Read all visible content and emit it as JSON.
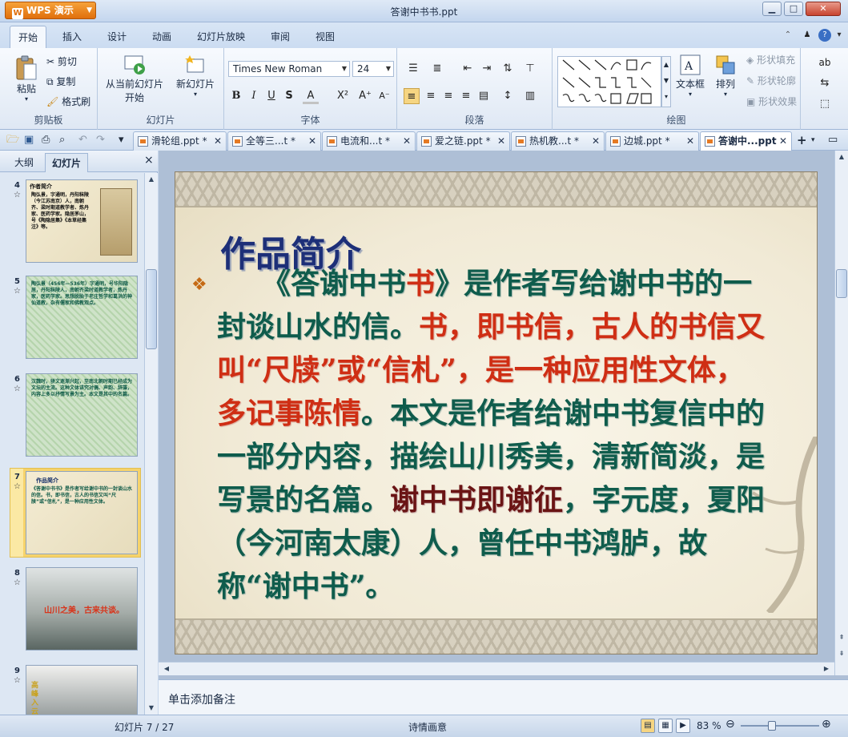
{
  "app": {
    "brand": "WPS 演示",
    "window_title": "答谢中书书.ppt"
  },
  "ribbon_tabs": [
    "开始",
    "插入",
    "设计",
    "动画",
    "幻灯片放映",
    "审阅",
    "视图"
  ],
  "clipboard": {
    "paste": "粘贴",
    "cut": "剪切",
    "copy": "复制",
    "format_painter": "格式刷",
    "label": "剪贴板"
  },
  "slides_group": {
    "from_current_1": "从当前幻灯片",
    "from_current_2": "开始",
    "new_slide": "新幻灯片",
    "label": "幻灯片"
  },
  "font_group": {
    "font_name": "Times New Roman",
    "font_size": "24",
    "label": "字体"
  },
  "paragraph_group": {
    "label": "段落"
  },
  "drawing_group": {
    "textbox": "文本框",
    "arrange": "排列",
    "shape_fill": "形状填充",
    "shape_outline": "形状轮廓",
    "shape_effects": "形状效果",
    "label": "绘图"
  },
  "doc_tabs": [
    {
      "label": "滑轮组.ppt *"
    },
    {
      "label": "全等三...t *"
    },
    {
      "label": "电流和...t *"
    },
    {
      "label": "爱之链.ppt *"
    },
    {
      "label": "热机教...t *"
    },
    {
      "label": "边城.ppt *"
    },
    {
      "label": "答谢中...ppt"
    }
  ],
  "left_panel": {
    "tab_outline": "大纲",
    "tab_slides": "幻灯片",
    "close": "×"
  },
  "thumbnails": [
    {
      "num": "4",
      "title": "作者简介",
      "text": "陶弘景，字通明，丹阳秣陵（今江苏南京）人，南朝齐、梁时期道教学者、炼丹家、医药学家。隐居茅山，号《陶隐居集》《本草经集注》等。"
    },
    {
      "num": "5",
      "title": "",
      "text": "陶弘景（456年—536年）字通明，号华阳隐居，丹阳秣陵人，南朝齐梁时道教学者，炼丹家，医药学家。思想脱胎于老庄哲学和葛洪的神仙道教，杂有儒家和佛教观点。"
    },
    {
      "num": "6",
      "title": "",
      "text": "汉魏时，骈文逐渐兴起，至南北朝时期已经成为文坛的主流。这种文体讲究对偶、声韵、辞藻，内容上多以抒情写景为主。本文是其中的名篇。"
    },
    {
      "num": "7",
      "title": "作品简介",
      "text": "《答谢中书书》是作者写给谢中书的一封谈山水的信。书，即书信，古人的书信又叫“尺牍”或“信札”，是一种应用性文体。"
    },
    {
      "num": "8",
      "title": "",
      "text": "山川之美，古来共谈。"
    },
    {
      "num": "9",
      "title": "",
      "text": "高峰入云"
    }
  ],
  "slide": {
    "title": "作品简介",
    "bullet": "❖",
    "body": [
      {
        "text": "《答谢中书",
        "style": "teal"
      },
      {
        "text": "书",
        "style": "red"
      },
      {
        "text": "》是作者写给谢中书的一封谈山水的信。",
        "style": "teal"
      },
      {
        "text": "书，即书信，古人的书信又叫“尺牍”或“信札”，是一种应用性文体，多记事陈情",
        "style": "red"
      },
      {
        "text": "。本文是作者给谢中书复信中的一部分内容，描绘山川秀美，清新简淡，是写景的名篇。",
        "style": "teal"
      },
      {
        "text": "谢中书即谢征",
        "style": "dred"
      },
      {
        "text": "，字元度，夏阳（今河南太康）人，曾任中书鸿胪，故称“谢中书”。",
        "style": "teal"
      }
    ]
  },
  "notes_placeholder": "单击添加备注",
  "status": {
    "slide_counter": "幻灯片 7 / 27",
    "theme": "诗情画意",
    "zoom": "83 %"
  },
  "colors": {
    "title_blue": "#1d2f78",
    "body_teal": "#0f5c4c",
    "accent_red": "#cf2e14",
    "dark_red": "#6a1414",
    "brand_orange": "#e06f0c"
  }
}
